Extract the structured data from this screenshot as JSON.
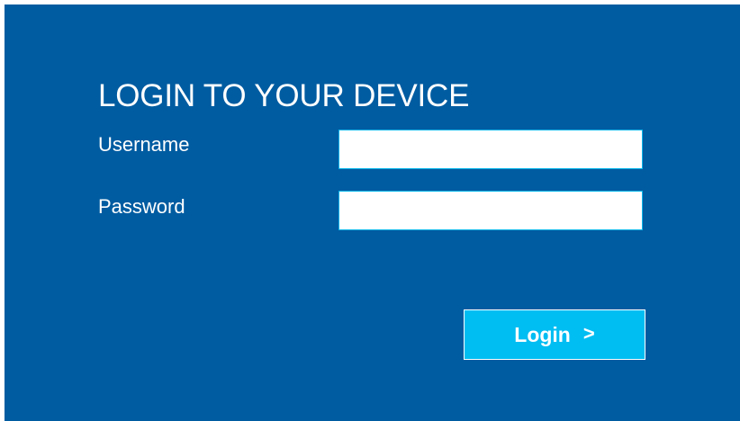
{
  "login_form": {
    "title": "LOGIN TO YOUR DEVICE",
    "username_label": "Username",
    "username_value": "",
    "password_label": "Password",
    "password_value": "",
    "login_button_label": "Login",
    "login_button_icon": "chevron-right-icon",
    "login_button_icon_glyph": ">"
  },
  "colors": {
    "panel_background": "#005ca1",
    "button_background": "#00bdf2",
    "field_border": "#00b3e8",
    "text": "#ffffff"
  }
}
